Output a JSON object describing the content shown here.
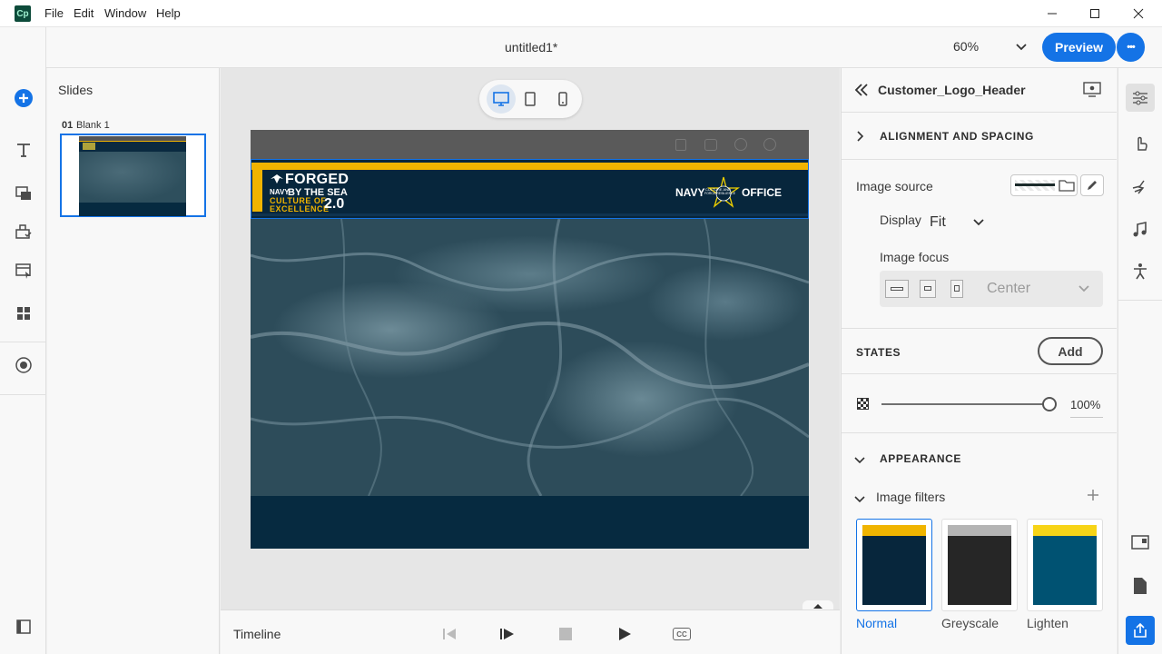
{
  "app": {
    "logo": "Cp"
  },
  "menu": {
    "file": "File",
    "edit": "Edit",
    "window": "Window",
    "help": "Help"
  },
  "toolbar": {
    "doc_title": "untitled1*",
    "zoom": "60%",
    "preview": "Preview",
    "more": "•••"
  },
  "slides_panel": {
    "title": "Slides",
    "slide_number": "01",
    "slide_name": "Blank 1"
  },
  "slide": {
    "header_forged": "FORGED",
    "header_navy": "NAVY",
    "header_bythesea": "BY THE SEA",
    "header_culture": "CULTURE OF",
    "header_excellence": "EXCELLENCE",
    "header_version": "2.0",
    "office_navy": "NAVY",
    "office_office": "OFFICE",
    "office_small1": "CULTURE AND",
    "office_small2": "FORCE RESILIENCE"
  },
  "timeline": {
    "label": "Timeline",
    "cc": "CC"
  },
  "properties": {
    "object_name": "Customer_Logo_Header",
    "alignment_section": "ALIGNMENT AND SPACING",
    "image_source_label": "Image source",
    "display_label": "Display",
    "display_value": "Fit",
    "image_focus_label": "Image focus",
    "focus_value": "Center",
    "states_label": "STATES",
    "add_button": "Add",
    "opacity_value": "100%",
    "opacity": 1.0,
    "appearance_section": "APPEARANCE",
    "image_filters_label": "Image filters",
    "filters": [
      {
        "name": "Normal",
        "top": "#f0b400",
        "bottom": "#07263c"
      },
      {
        "name": "Greyscale",
        "top": "#b4b4b4",
        "bottom": "#262626"
      },
      {
        "name": "Lighten",
        "top": "#f7d417",
        "bottom": "#005272"
      }
    ]
  },
  "colors": {
    "accent": "#1473e6",
    "navy": "#07263c",
    "gold": "#f0b400"
  }
}
